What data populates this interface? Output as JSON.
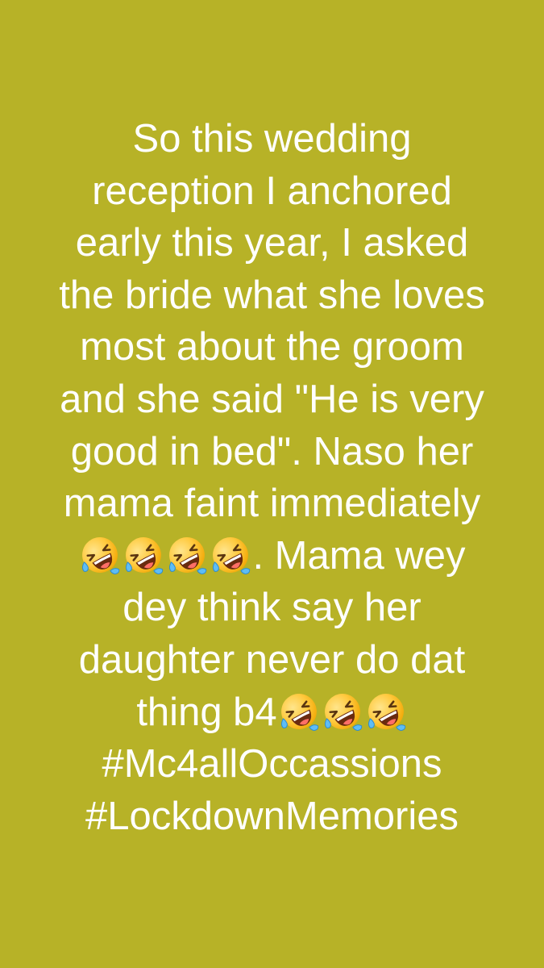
{
  "background_color": "#b7b227",
  "text_color": "#ffffff",
  "emoji_name": "rolling-on-the-floor-laughing-icon",
  "story": {
    "line1": "So this wedding",
    "line2": "reception I anchored",
    "line3": "early this year, I asked",
    "line4": "the bride what she loves",
    "line5": "most about the groom",
    "line6": "and she said \"He is very",
    "line7": "good in bed\". Naso her",
    "line8": "mama faint immediately",
    "line9_tail": ". Mama wey",
    "line10": "dey think say her",
    "line11": "daughter never do dat",
    "line12_head": "thing b4",
    "hashtag1": "#Mc4allOccassions",
    "hashtag2": "#LockdownMemories"
  }
}
